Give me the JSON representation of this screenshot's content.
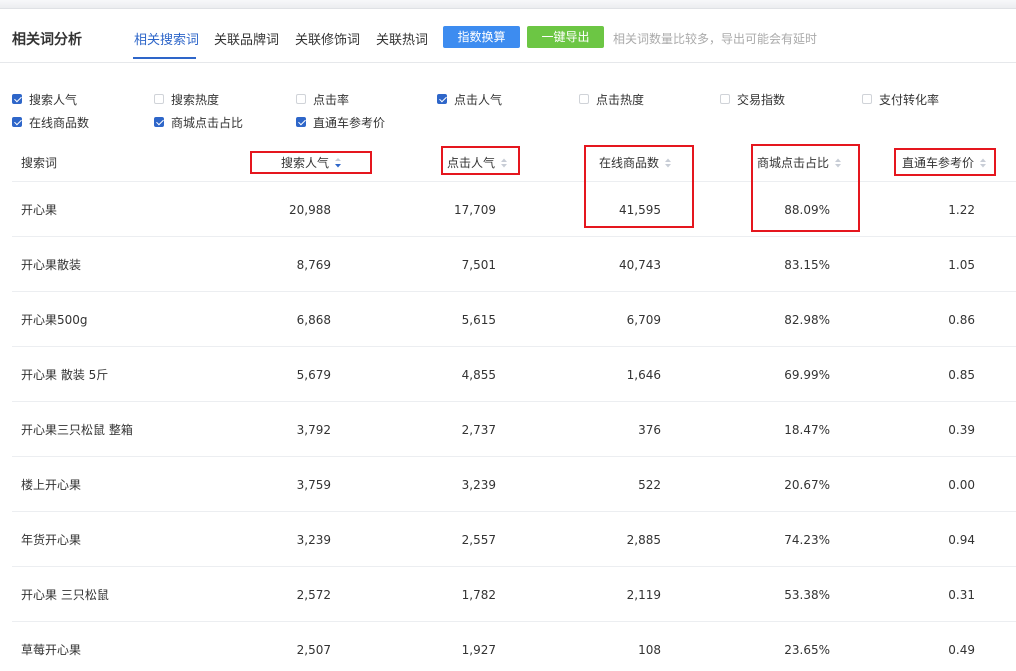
{
  "header": {
    "title": "相关词分析",
    "tabs": [
      {
        "label": "相关搜索词",
        "active": true
      },
      {
        "label": "关联品牌词",
        "active": false
      },
      {
        "label": "关联修饰词",
        "active": false
      },
      {
        "label": "关联热词",
        "active": false
      }
    ],
    "buttons": {
      "index_convert": "指数换算",
      "export": "一键导出"
    },
    "note": "相关词数量比较多，导出可能会有延时"
  },
  "options": [
    {
      "label": "搜索人气",
      "checked": true
    },
    {
      "label": "搜索热度",
      "checked": false
    },
    {
      "label": "点击率",
      "checked": false
    },
    {
      "label": "点击人气",
      "checked": true
    },
    {
      "label": "点击热度",
      "checked": false
    },
    {
      "label": "交易指数",
      "checked": false
    },
    {
      "label": "支付转化率",
      "checked": false
    },
    {
      "label": "在线商品数",
      "checked": true
    },
    {
      "label": "商城点击占比",
      "checked": true
    },
    {
      "label": "直通车参考价",
      "checked": true
    }
  ],
  "table": {
    "columns": [
      "搜索词",
      "搜索人气",
      "点击人气",
      "在线商品数",
      "商城点击占比",
      "直通车参考价"
    ],
    "rows": [
      [
        "开心果",
        "20,988",
        "17,709",
        "41,595",
        "88.09%",
        "1.22"
      ],
      [
        "开心果散装",
        "8,769",
        "7,501",
        "40,743",
        "83.15%",
        "1.05"
      ],
      [
        "开心果500g",
        "6,868",
        "5,615",
        "6,709",
        "82.98%",
        "0.86"
      ],
      [
        "开心果 散装 5斤",
        "5,679",
        "4,855",
        "1,646",
        "69.99%",
        "0.85"
      ],
      [
        "开心果三只松鼠 整箱",
        "3,792",
        "2,737",
        "376",
        "18.47%",
        "0.39"
      ],
      [
        "楼上开心果",
        "3,759",
        "3,239",
        "522",
        "20.67%",
        "0.00"
      ],
      [
        "年货开心果",
        "3,239",
        "2,557",
        "2,885",
        "74.23%",
        "0.94"
      ],
      [
        "开心果 三只松鼠",
        "2,572",
        "1,782",
        "2,119",
        "53.38%",
        "0.31"
      ],
      [
        "草莓开心果",
        "2,507",
        "1,927",
        "108",
        "23.65%",
        "0.49"
      ]
    ]
  },
  "colors": {
    "accent": "#2e66c9",
    "blue_button": "#3d8cf0",
    "green_button": "#6cc644",
    "highlight": "#e5161e"
  }
}
